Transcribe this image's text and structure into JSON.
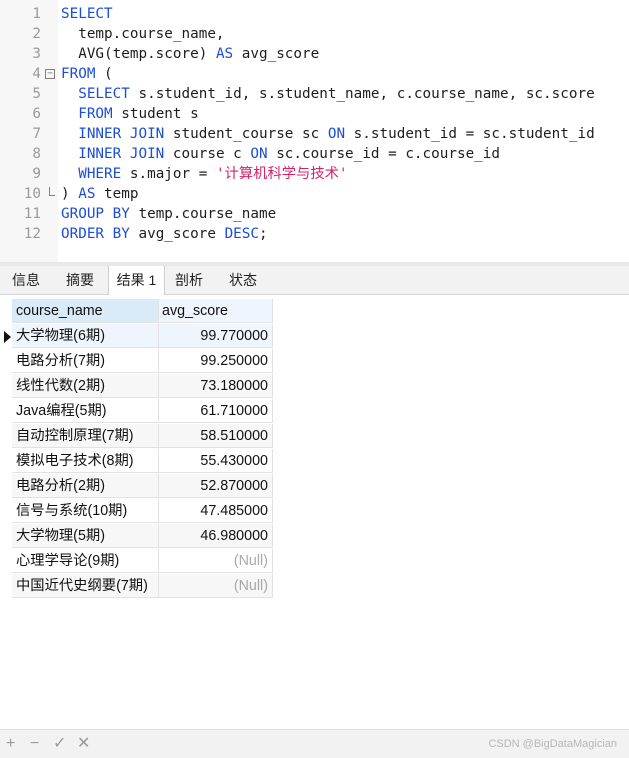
{
  "editor": {
    "lines": [
      {
        "n": "1",
        "tokens": [
          {
            "t": "SELECT",
            "c": "kw"
          }
        ]
      },
      {
        "n": "2",
        "tokens": [
          {
            "t": "  temp.course_name,",
            "c": ""
          }
        ]
      },
      {
        "n": "3",
        "tokens": [
          {
            "t": "  AVG(temp.score) ",
            "c": ""
          },
          {
            "t": "AS",
            "c": "kw"
          },
          {
            "t": " avg_score",
            "c": ""
          }
        ]
      },
      {
        "n": "4",
        "fold": "open",
        "tokens": [
          {
            "t": "FROM",
            "c": "kw"
          },
          {
            "t": " (",
            "c": ""
          }
        ]
      },
      {
        "n": "5",
        "tokens": [
          {
            "t": "  ",
            "c": ""
          },
          {
            "t": "SELECT",
            "c": "kw"
          },
          {
            "t": " s.student_id, s.student_name, c.course_name, sc.score",
            "c": ""
          }
        ]
      },
      {
        "n": "6",
        "tokens": [
          {
            "t": "  ",
            "c": ""
          },
          {
            "t": "FROM",
            "c": "kw"
          },
          {
            "t": " student s",
            "c": ""
          }
        ]
      },
      {
        "n": "7",
        "tokens": [
          {
            "t": "  ",
            "c": ""
          },
          {
            "t": "INNER JOIN",
            "c": "kw"
          },
          {
            "t": " student_course sc ",
            "c": ""
          },
          {
            "t": "ON",
            "c": "kw"
          },
          {
            "t": " s.student_id = sc.student_id",
            "c": ""
          }
        ]
      },
      {
        "n": "8",
        "tokens": [
          {
            "t": "  ",
            "c": ""
          },
          {
            "t": "INNER JOIN",
            "c": "kw"
          },
          {
            "t": " course c ",
            "c": ""
          },
          {
            "t": "ON",
            "c": "kw"
          },
          {
            "t": " sc.course_id = c.course_id",
            "c": ""
          }
        ]
      },
      {
        "n": "9",
        "tokens": [
          {
            "t": "  ",
            "c": ""
          },
          {
            "t": "WHERE",
            "c": "kw"
          },
          {
            "t": " s.major = ",
            "c": ""
          },
          {
            "t": "'计算机科学与技术'",
            "c": "str"
          }
        ]
      },
      {
        "n": "10",
        "fold": "end",
        "tokens": [
          {
            "t": ") ",
            "c": ""
          },
          {
            "t": "AS",
            "c": "kw"
          },
          {
            "t": " temp",
            "c": ""
          }
        ]
      },
      {
        "n": "11",
        "tokens": [
          {
            "t": "GROUP BY",
            "c": "kw"
          },
          {
            "t": " temp.course_name",
            "c": ""
          }
        ]
      },
      {
        "n": "12",
        "tokens": [
          {
            "t": "ORDER BY",
            "c": "kw"
          },
          {
            "t": " avg_score ",
            "c": ""
          },
          {
            "t": "DESC",
            "c": "kw"
          },
          {
            "t": ";",
            "c": ""
          }
        ]
      }
    ]
  },
  "tabs": [
    {
      "label": "信息",
      "active": false
    },
    {
      "label": "摘要",
      "active": false
    },
    {
      "label": "结果 1",
      "active": true
    },
    {
      "label": "剖析",
      "active": false
    },
    {
      "label": "状态",
      "active": false
    }
  ],
  "grid": {
    "columns": [
      "course_name",
      "avg_score"
    ],
    "rows": [
      {
        "course_name": "大学物理(6期)",
        "avg_score": "99.770000"
      },
      {
        "course_name": "电路分析(7期)",
        "avg_score": "99.250000"
      },
      {
        "course_name": "线性代数(2期)",
        "avg_score": "73.180000"
      },
      {
        "course_name": "Java编程(5期)",
        "avg_score": "61.710000"
      },
      {
        "course_name": "自动控制原理(7期)",
        "avg_score": "58.510000"
      },
      {
        "course_name": "模拟电子技术(8期)",
        "avg_score": "55.430000"
      },
      {
        "course_name": "电路分析(2期)",
        "avg_score": "52.870000"
      },
      {
        "course_name": "信号与系统(10期)",
        "avg_score": "47.485000"
      },
      {
        "course_name": "大学物理(5期)",
        "avg_score": "46.980000"
      },
      {
        "course_name": "心理学导论(9期)",
        "avg_score": "(Null)"
      },
      {
        "course_name": "中国近代史纲要(7期)",
        "avg_score": "(Null)"
      }
    ],
    "selected_row": 0
  },
  "toolbar": {
    "icons": [
      {
        "name": "add-record-icon",
        "glyph": "+"
      },
      {
        "name": "delete-record-icon",
        "glyph": "−"
      },
      {
        "name": "apply-changes-icon",
        "glyph": "✓"
      },
      {
        "name": "discard-changes-icon",
        "glyph": "✕"
      }
    ],
    "watermark": "CSDN @BigDataMagician"
  }
}
